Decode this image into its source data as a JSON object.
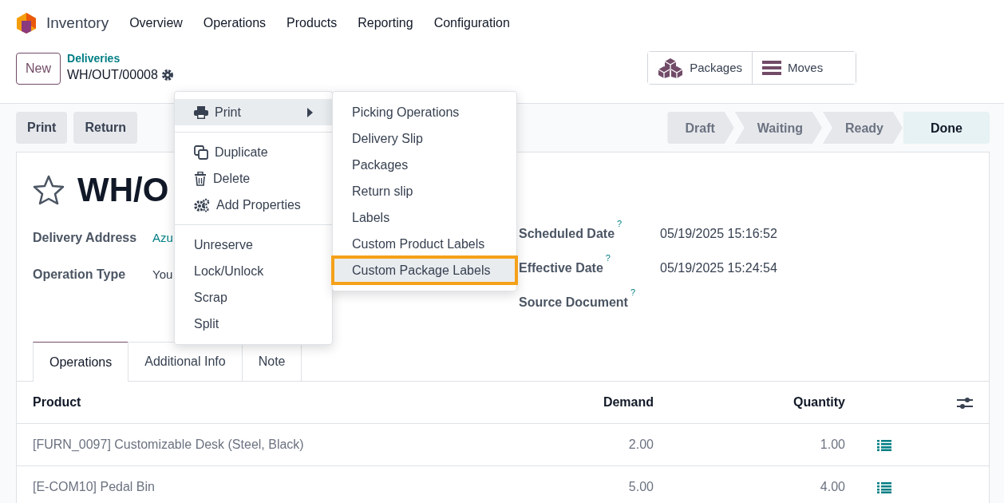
{
  "app": {
    "name": "Inventory"
  },
  "nav_menu": [
    "Overview",
    "Operations",
    "Products",
    "Reporting",
    "Configuration"
  ],
  "control_panel": {
    "new_button": "New",
    "breadcrumb_parent": "Deliveries",
    "breadcrumb_current": "WH/OUT/00008",
    "smart_buttons": [
      {
        "label": "Packages"
      },
      {
        "label": "Moves"
      }
    ]
  },
  "actions": [
    "Print",
    "Return"
  ],
  "statusbar": [
    {
      "label": "Draft",
      "selected": false
    },
    {
      "label": "Waiting",
      "selected": false
    },
    {
      "label": "Ready",
      "selected": false
    },
    {
      "label": "Done",
      "selected": true
    }
  ],
  "form": {
    "starred": false,
    "title": "WH/O",
    "left_fields": [
      {
        "label": "Delivery Address",
        "value": "Azu",
        "kind": "link"
      },
      {
        "label": "Operation Type",
        "value": "You",
        "kind": "text"
      }
    ],
    "right_fields": [
      {
        "label": "Scheduled Date",
        "help": "?",
        "value": "05/19/2025 15:16:52"
      },
      {
        "label": "Effective Date",
        "help": "?",
        "value": "05/19/2025 15:24:54"
      },
      {
        "label": "Source Document",
        "help": "?"
      }
    ],
    "tabs": [
      {
        "label": "Operations",
        "selected": true
      },
      {
        "label": "Additional Info",
        "selected": false
      },
      {
        "label": "Note",
        "selected": false
      }
    ]
  },
  "table": {
    "columns": [
      "Product",
      "Demand",
      "Quantity"
    ],
    "rows": [
      {
        "product": "[FURN_0097] Customizable Desk (Steel, Black)",
        "demand": "2.00",
        "quantity": "1.00"
      },
      {
        "product": "[E-COM10] Pedal Bin",
        "demand": "5.00",
        "quantity": "4.00"
      }
    ]
  },
  "gear_menu": {
    "sections": [
      [
        {
          "label": "Print",
          "submenu": true,
          "selected": true
        }
      ],
      [
        {
          "label": "Duplicate",
          "submenu": false,
          "selected": false
        },
        {
          "label": "Delete",
          "submenu": false,
          "selected": false
        },
        {
          "label": "Add Properties",
          "submenu": false,
          "selected": false
        }
      ],
      [
        {
          "label": "Unreserve",
          "submenu": false,
          "selected": false
        },
        {
          "label": "Lock/Unlock",
          "submenu": false,
          "selected": false
        },
        {
          "label": "Scrap",
          "submenu": false,
          "selected": false
        },
        {
          "label": "Split",
          "submenu": false,
          "selected": false
        }
      ]
    ],
    "print_submenu": [
      {
        "label": "Picking Operations",
        "selected": false,
        "highlighted": false
      },
      {
        "label": "Delivery Slip",
        "selected": false,
        "highlighted": false
      },
      {
        "label": "Packages",
        "selected": false,
        "highlighted": false
      },
      {
        "label": "Return slip",
        "selected": false,
        "highlighted": false
      },
      {
        "label": "Labels",
        "selected": false,
        "highlighted": false
      },
      {
        "label": "Custom Product Labels",
        "selected": false,
        "highlighted": false
      },
      {
        "label": "Custom Package Labels",
        "selected": true,
        "highlighted": true
      }
    ]
  }
}
